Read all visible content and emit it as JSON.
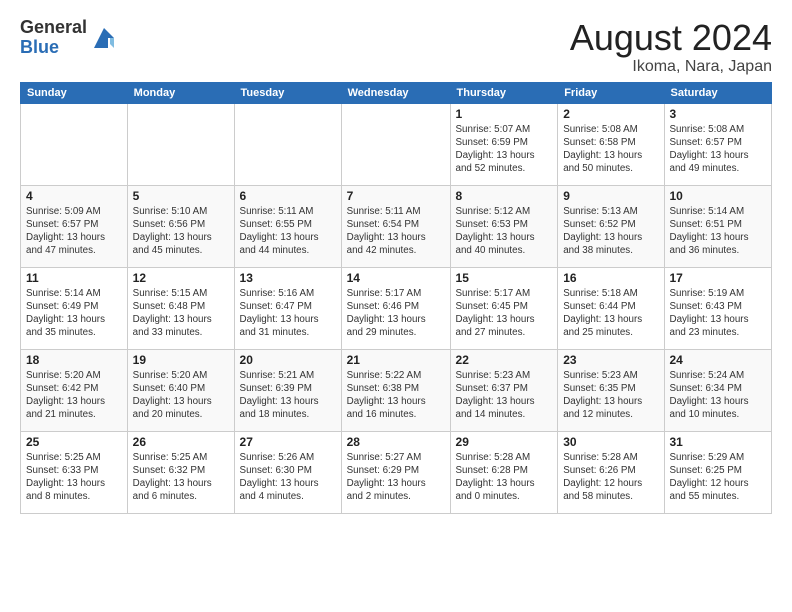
{
  "header": {
    "logo_general": "General",
    "logo_blue": "Blue",
    "title": "August 2024",
    "location": "Ikoma, Nara, Japan"
  },
  "weekdays": [
    "Sunday",
    "Monday",
    "Tuesday",
    "Wednesday",
    "Thursday",
    "Friday",
    "Saturday"
  ],
  "weeks": [
    [
      {
        "day": "",
        "info": ""
      },
      {
        "day": "",
        "info": ""
      },
      {
        "day": "",
        "info": ""
      },
      {
        "day": "",
        "info": ""
      },
      {
        "day": "1",
        "info": "Sunrise: 5:07 AM\nSunset: 6:59 PM\nDaylight: 13 hours\nand 52 minutes."
      },
      {
        "day": "2",
        "info": "Sunrise: 5:08 AM\nSunset: 6:58 PM\nDaylight: 13 hours\nand 50 minutes."
      },
      {
        "day": "3",
        "info": "Sunrise: 5:08 AM\nSunset: 6:57 PM\nDaylight: 13 hours\nand 49 minutes."
      }
    ],
    [
      {
        "day": "4",
        "info": "Sunrise: 5:09 AM\nSunset: 6:57 PM\nDaylight: 13 hours\nand 47 minutes."
      },
      {
        "day": "5",
        "info": "Sunrise: 5:10 AM\nSunset: 6:56 PM\nDaylight: 13 hours\nand 45 minutes."
      },
      {
        "day": "6",
        "info": "Sunrise: 5:11 AM\nSunset: 6:55 PM\nDaylight: 13 hours\nand 44 minutes."
      },
      {
        "day": "7",
        "info": "Sunrise: 5:11 AM\nSunset: 6:54 PM\nDaylight: 13 hours\nand 42 minutes."
      },
      {
        "day": "8",
        "info": "Sunrise: 5:12 AM\nSunset: 6:53 PM\nDaylight: 13 hours\nand 40 minutes."
      },
      {
        "day": "9",
        "info": "Sunrise: 5:13 AM\nSunset: 6:52 PM\nDaylight: 13 hours\nand 38 minutes."
      },
      {
        "day": "10",
        "info": "Sunrise: 5:14 AM\nSunset: 6:51 PM\nDaylight: 13 hours\nand 36 minutes."
      }
    ],
    [
      {
        "day": "11",
        "info": "Sunrise: 5:14 AM\nSunset: 6:49 PM\nDaylight: 13 hours\nand 35 minutes."
      },
      {
        "day": "12",
        "info": "Sunrise: 5:15 AM\nSunset: 6:48 PM\nDaylight: 13 hours\nand 33 minutes."
      },
      {
        "day": "13",
        "info": "Sunrise: 5:16 AM\nSunset: 6:47 PM\nDaylight: 13 hours\nand 31 minutes."
      },
      {
        "day": "14",
        "info": "Sunrise: 5:17 AM\nSunset: 6:46 PM\nDaylight: 13 hours\nand 29 minutes."
      },
      {
        "day": "15",
        "info": "Sunrise: 5:17 AM\nSunset: 6:45 PM\nDaylight: 13 hours\nand 27 minutes."
      },
      {
        "day": "16",
        "info": "Sunrise: 5:18 AM\nSunset: 6:44 PM\nDaylight: 13 hours\nand 25 minutes."
      },
      {
        "day": "17",
        "info": "Sunrise: 5:19 AM\nSunset: 6:43 PM\nDaylight: 13 hours\nand 23 minutes."
      }
    ],
    [
      {
        "day": "18",
        "info": "Sunrise: 5:20 AM\nSunset: 6:42 PM\nDaylight: 13 hours\nand 21 minutes."
      },
      {
        "day": "19",
        "info": "Sunrise: 5:20 AM\nSunset: 6:40 PM\nDaylight: 13 hours\nand 20 minutes."
      },
      {
        "day": "20",
        "info": "Sunrise: 5:21 AM\nSunset: 6:39 PM\nDaylight: 13 hours\nand 18 minutes."
      },
      {
        "day": "21",
        "info": "Sunrise: 5:22 AM\nSunset: 6:38 PM\nDaylight: 13 hours\nand 16 minutes."
      },
      {
        "day": "22",
        "info": "Sunrise: 5:23 AM\nSunset: 6:37 PM\nDaylight: 13 hours\nand 14 minutes."
      },
      {
        "day": "23",
        "info": "Sunrise: 5:23 AM\nSunset: 6:35 PM\nDaylight: 13 hours\nand 12 minutes."
      },
      {
        "day": "24",
        "info": "Sunrise: 5:24 AM\nSunset: 6:34 PM\nDaylight: 13 hours\nand 10 minutes."
      }
    ],
    [
      {
        "day": "25",
        "info": "Sunrise: 5:25 AM\nSunset: 6:33 PM\nDaylight: 13 hours\nand 8 minutes."
      },
      {
        "day": "26",
        "info": "Sunrise: 5:25 AM\nSunset: 6:32 PM\nDaylight: 13 hours\nand 6 minutes."
      },
      {
        "day": "27",
        "info": "Sunrise: 5:26 AM\nSunset: 6:30 PM\nDaylight: 13 hours\nand 4 minutes."
      },
      {
        "day": "28",
        "info": "Sunrise: 5:27 AM\nSunset: 6:29 PM\nDaylight: 13 hours\nand 2 minutes."
      },
      {
        "day": "29",
        "info": "Sunrise: 5:28 AM\nSunset: 6:28 PM\nDaylight: 13 hours\nand 0 minutes."
      },
      {
        "day": "30",
        "info": "Sunrise: 5:28 AM\nSunset: 6:26 PM\nDaylight: 12 hours\nand 58 minutes."
      },
      {
        "day": "31",
        "info": "Sunrise: 5:29 AM\nSunset: 6:25 PM\nDaylight: 12 hours\nand 55 minutes."
      }
    ]
  ]
}
